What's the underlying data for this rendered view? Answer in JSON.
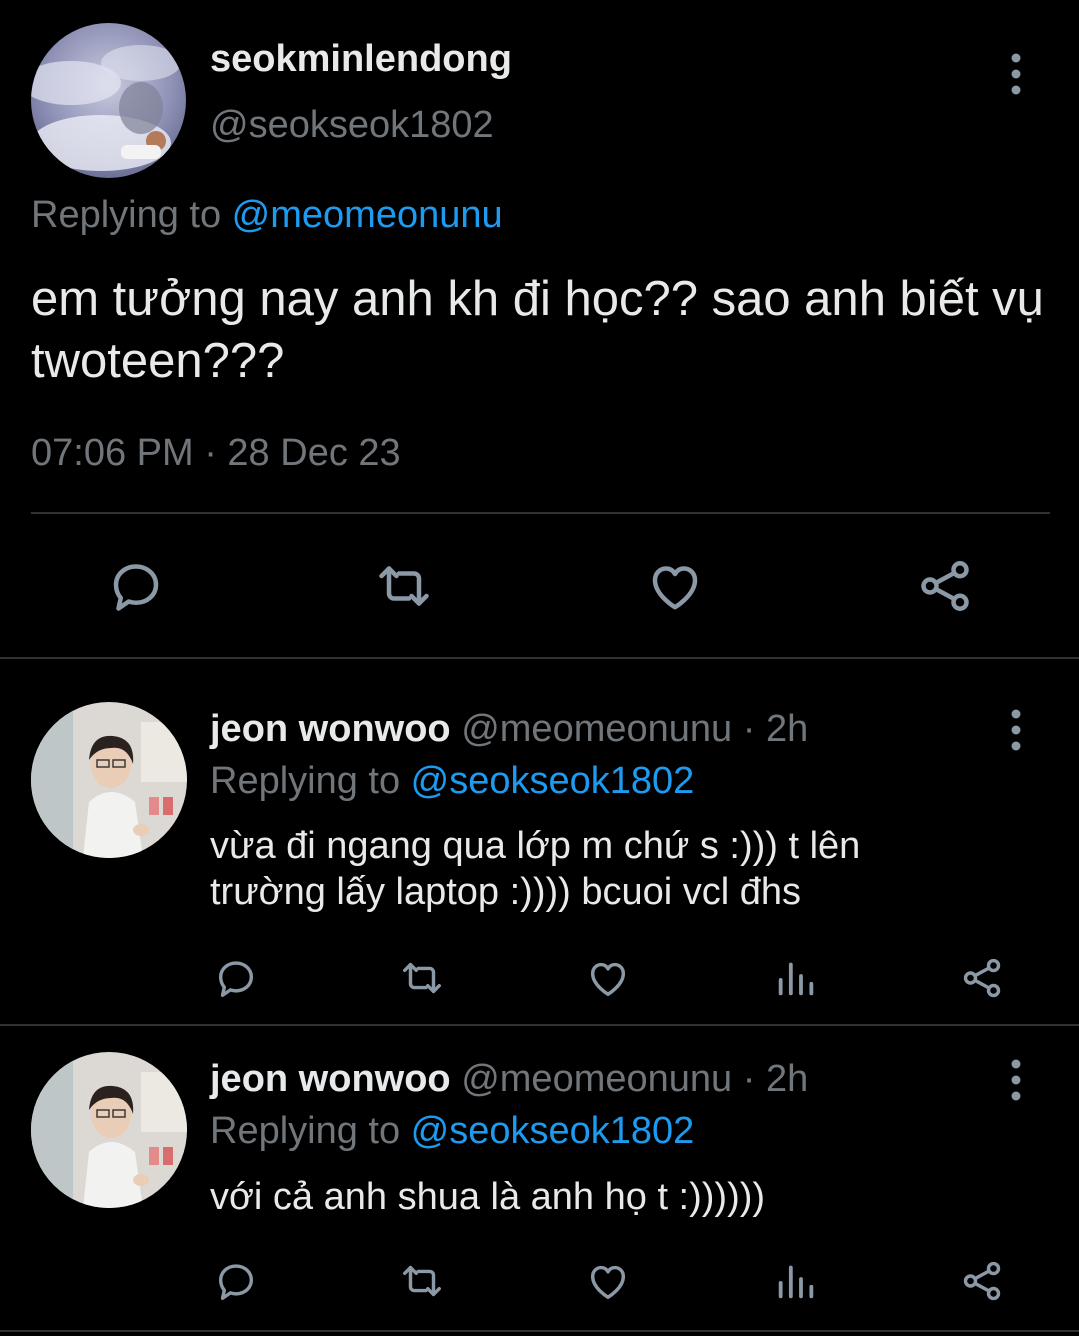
{
  "main_tweet": {
    "display_name": "seokminlendong",
    "handle": "@seokseok1802",
    "replying_prefix": "Replying to ",
    "replying_handle": "@meomeonunu",
    "text": "em tưởng nay anh kh đi học?? sao anh biết vụ twoteen???",
    "timestamp": "07:06 PM · 28 Dec 23",
    "actions": [
      "reply-icon",
      "retweet-icon",
      "like-icon",
      "share-icon"
    ]
  },
  "replies": [
    {
      "display_name": "jeon wonwoo",
      "handle": "@meomeonunu",
      "time": " · 2h",
      "replying_prefix": "Replying to ",
      "replying_handle": "@seokseok1802",
      "text_lines": [
        "vừa đi ngang qua lớp m chứ s :))) t lên",
        "trường lấy laptop :)))) bcuoi vcl đhs"
      ],
      "actions": [
        "reply-icon",
        "retweet-icon",
        "like-icon",
        "analytics-icon",
        "share-icon"
      ]
    },
    {
      "display_name": "jeon wonwoo",
      "handle": "@meomeonunu",
      "time": " · 2h",
      "replying_prefix": "Replying to ",
      "replying_handle": "@seokseok1802",
      "text_lines": [
        "với cả anh shua là anh họ t :))))))"
      ],
      "actions": [
        "reply-icon",
        "retweet-icon",
        "like-icon",
        "analytics-icon",
        "share-icon"
      ]
    }
  ],
  "colors": {
    "background": "#000000",
    "text": "#e7e9ea",
    "muted": "#71767b",
    "link": "#1d9bf0",
    "divider": "#2f3336",
    "icon": "#8b98a5"
  }
}
